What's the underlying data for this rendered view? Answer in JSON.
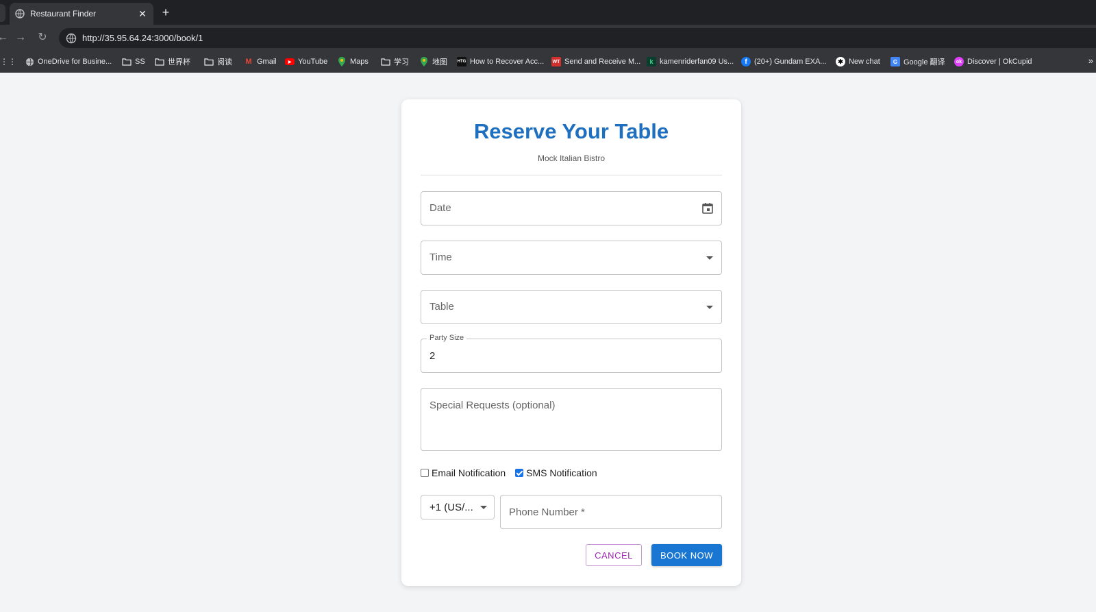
{
  "browser": {
    "tab_title": "Restaurant Finder",
    "tab_close": "✕",
    "new_tab": "+",
    "url": "http://35.95.64.24:3000/book/1",
    "bookmarks": [
      {
        "label": "OneDrive for Busine...",
        "icon": "globe-icon"
      },
      {
        "label": "SS",
        "icon": "folder-icon"
      },
      {
        "label": "世界杯",
        "icon": "folder-icon"
      },
      {
        "label": "阅读",
        "icon": "folder-icon"
      },
      {
        "label": "Gmail",
        "icon": "gmail-icon"
      },
      {
        "label": "YouTube",
        "icon": "youtube-icon"
      },
      {
        "label": "Maps",
        "icon": "maps-icon"
      },
      {
        "label": "学习",
        "icon": "folder-icon"
      },
      {
        "label": "地图",
        "icon": "maps-icon"
      },
      {
        "label": "How to Recover Acc...",
        "icon": "htg-icon"
      },
      {
        "label": "Send and Receive M...",
        "icon": "wt-icon"
      },
      {
        "label": "kamenriderfan09 Us...",
        "icon": "k-icon"
      },
      {
        "label": "(20+) Gundam EXA...",
        "icon": "facebook-icon"
      },
      {
        "label": "New chat",
        "icon": "chat-icon"
      },
      {
        "label": "Google 翻译",
        "icon": "translate-icon"
      },
      {
        "label": "Discover | OkCupid",
        "icon": "okcupid-icon"
      }
    ],
    "more": "»"
  },
  "form": {
    "title": "Reserve Your Table",
    "subtitle": "Mock Italian Bistro",
    "date_label": "Date",
    "time_label": "Time",
    "table_label": "Table",
    "party_size_label": "Party Size",
    "party_size_value": "2",
    "special_requests_placeholder": "Special Requests (optional)",
    "email_notification_label": "Email Notification",
    "email_notification_checked": false,
    "sms_notification_label": "SMS Notification",
    "sms_notification_checked": true,
    "country_code_value": "+1 (US/...",
    "phone_placeholder": "Phone Number *",
    "cancel_label": "CANCEL",
    "book_label": "BOOK NOW"
  },
  "colors": {
    "title": "#1e6fbf",
    "primary_button": "#1976d2",
    "cancel_text": "#9c27b0",
    "checkbox_on": "#1a73e8"
  }
}
